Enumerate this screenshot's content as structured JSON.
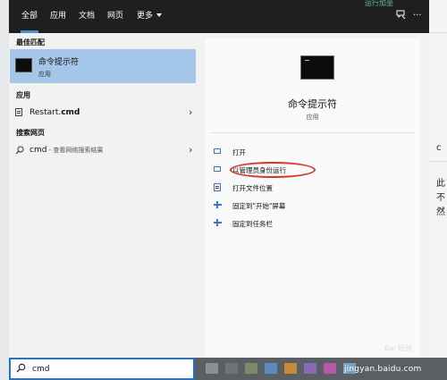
{
  "topbar": {
    "tabs": [
      {
        "label": "全部",
        "active": true
      },
      {
        "label": "应用",
        "active": false
      },
      {
        "label": "文档",
        "active": false
      },
      {
        "label": "网页",
        "active": false
      },
      {
        "label": "更多",
        "active": false
      }
    ],
    "feedback_icon": "feedback-icon",
    "more_icon_glyph": "···",
    "partial_link_text": "运行加坐"
  },
  "left": {
    "best_match_header": "最佳匹配",
    "best_match": {
      "title": "命令提示符",
      "subtitle": "应用",
      "icon": "cmd-tile-icon"
    },
    "apps_header": "应用",
    "apps": [
      {
        "label_prefix": "Restart.",
        "label_bold": "cmd",
        "icon": "document-icon"
      }
    ],
    "web_header": "搜索网页",
    "web": [
      {
        "query": "cmd",
        "suffix": " - 查看网络搜索结果",
        "icon": "search-icon"
      }
    ]
  },
  "detail": {
    "title": "命令提示符",
    "subtitle": "应用",
    "actions": [
      {
        "label": "打开",
        "icon": "open-icon"
      },
      {
        "label": "以管理员身份运行",
        "icon": "run-as-admin-icon"
      },
      {
        "label": "打开文件位置",
        "icon": "folder-location-icon"
      },
      {
        "label": "固定到\"开始\"屏幕",
        "icon": "pin-start-icon"
      },
      {
        "label": "固定到任务栏",
        "icon": "pin-taskbar-icon"
      }
    ],
    "annotation_color": "#d9362b"
  },
  "search": {
    "value": "cmd",
    "icon": "search-icon"
  },
  "background_app": {
    "chars": [
      "c",
      "此",
      "不",
      "然"
    ]
  },
  "watermark": {
    "text": "jingyan.baidu.com",
    "logo_text": "Bai 经验"
  },
  "colors": {
    "accent": "#4a91d6",
    "selected": "#a4c7e9",
    "topbar": "#1f1f1f",
    "search_border": "#2b73c2"
  }
}
